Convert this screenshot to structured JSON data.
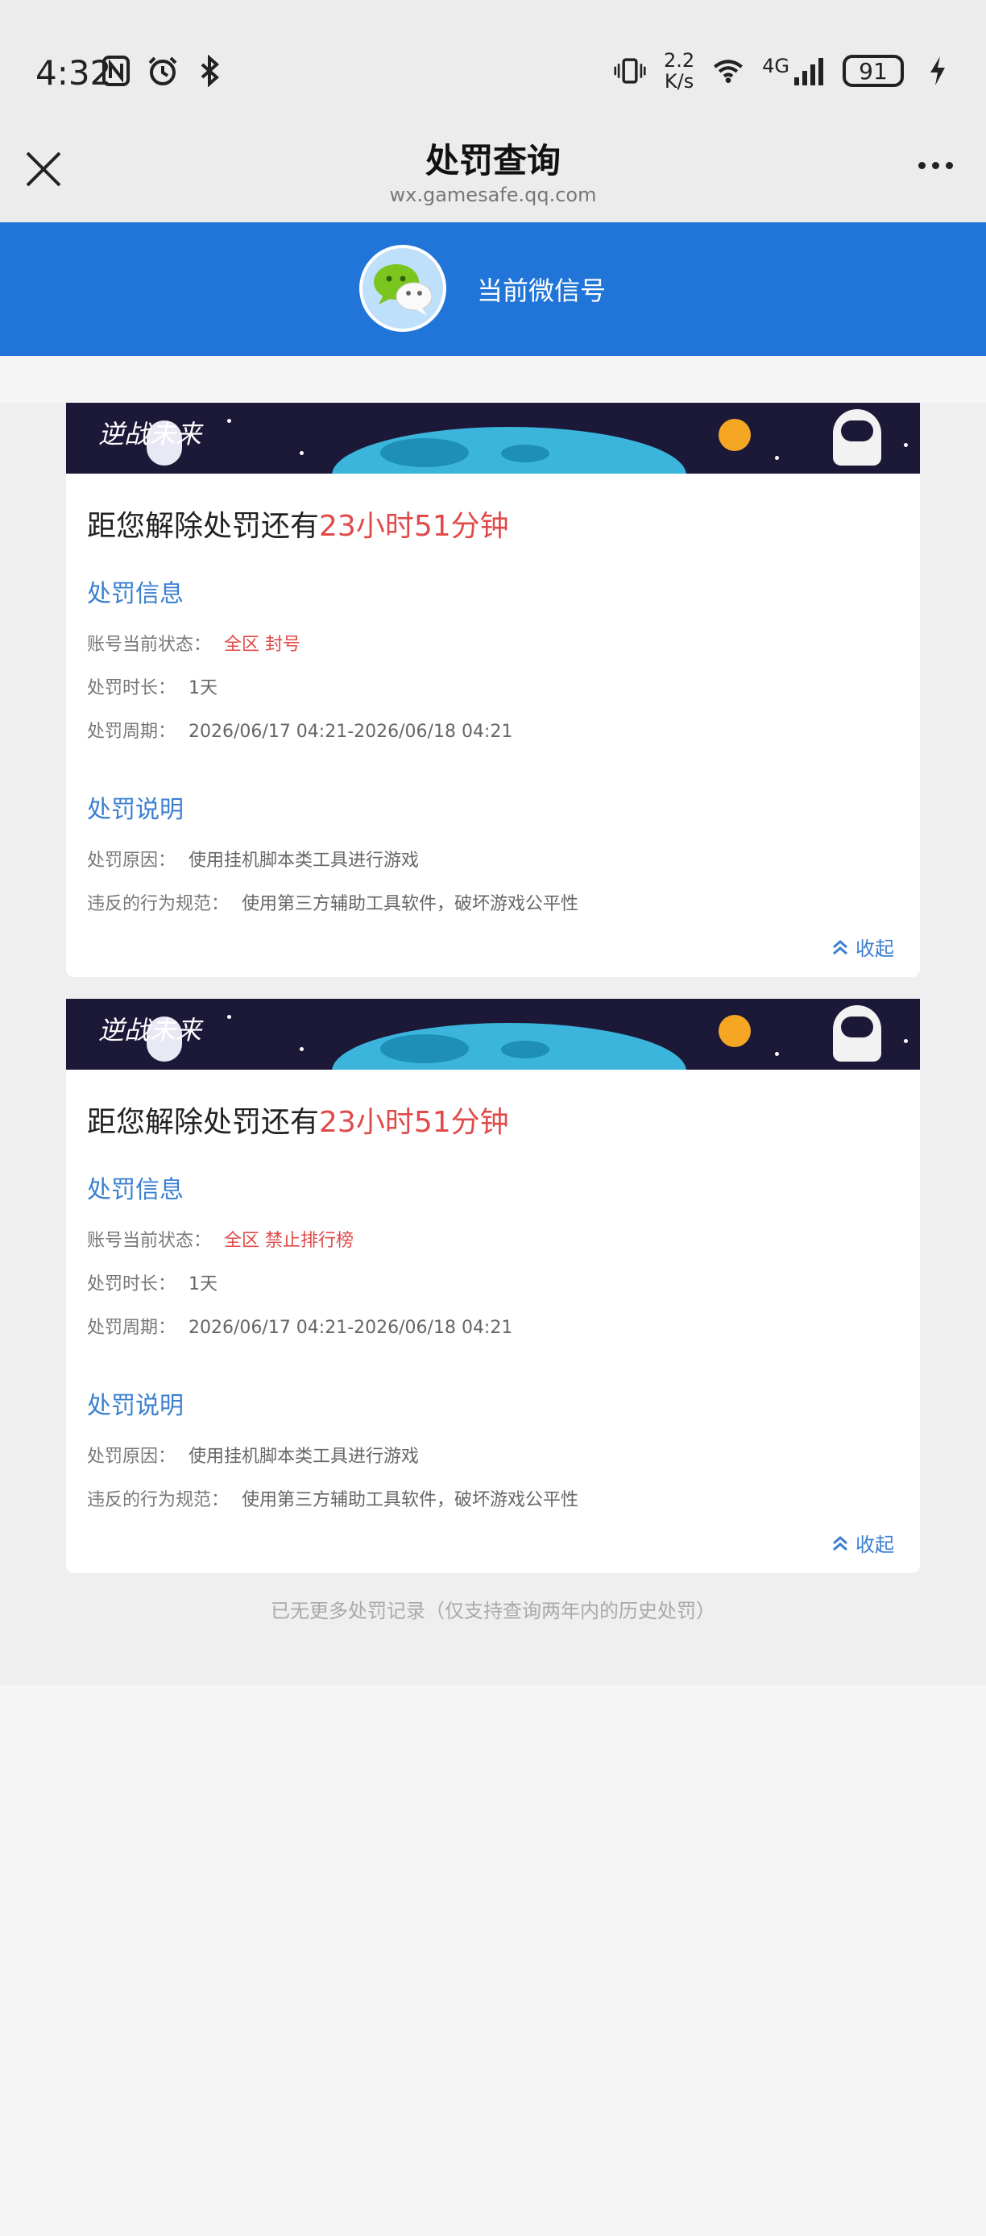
{
  "status": {
    "time": "4:32",
    "speed_value": "2.2",
    "speed_unit": "K/s",
    "network": "4G",
    "battery": "91"
  },
  "nav": {
    "title": "处罚查询",
    "url": "wx.gamesafe.qq.com"
  },
  "banner": {
    "label": "当前微信号"
  },
  "cards": [
    {
      "game": "逆战未来",
      "countdown_prefix": "距您解除处罚还有",
      "countdown_value": "23小时51分钟",
      "info_title": "处罚信息",
      "status_label": "账号当前状态：",
      "status_value": "全区 封号",
      "duration_label": "处罚时长：",
      "duration_value": "1天",
      "period_label": "处罚周期：",
      "period_value": "2026/06/17 04:21-2026/06/18 04:21",
      "desc_title": "处罚说明",
      "reason_label": "处罚原因：",
      "reason_value": "使用挂机脚本类工具进行游戏",
      "rule_label": "违反的行为规范：",
      "rule_value": "使用第三方辅助工具软件，破坏游戏公平性",
      "collapse": "收起"
    },
    {
      "game": "逆战未来",
      "countdown_prefix": "距您解除处罚还有",
      "countdown_value": "23小时51分钟",
      "info_title": "处罚信息",
      "status_label": "账号当前状态：",
      "status_value": "全区 禁止排行榜",
      "duration_label": "处罚时长：",
      "duration_value": "1天",
      "period_label": "处罚周期：",
      "period_value": "2026/06/17 04:21-2026/06/18 04:21",
      "desc_title": "处罚说明",
      "reason_label": "处罚原因：",
      "reason_value": "使用挂机脚本类工具进行游戏",
      "rule_label": "违反的行为规范：",
      "rule_value": "使用第三方辅助工具软件，破坏游戏公平性",
      "collapse": "收起"
    }
  ],
  "footer": "已无更多处罚记录（仅支持查询两年内的历史处罚）",
  "colors": {
    "banner": "#2175d9",
    "accent": "#3b7fd1",
    "alert": "#e04a4a"
  }
}
